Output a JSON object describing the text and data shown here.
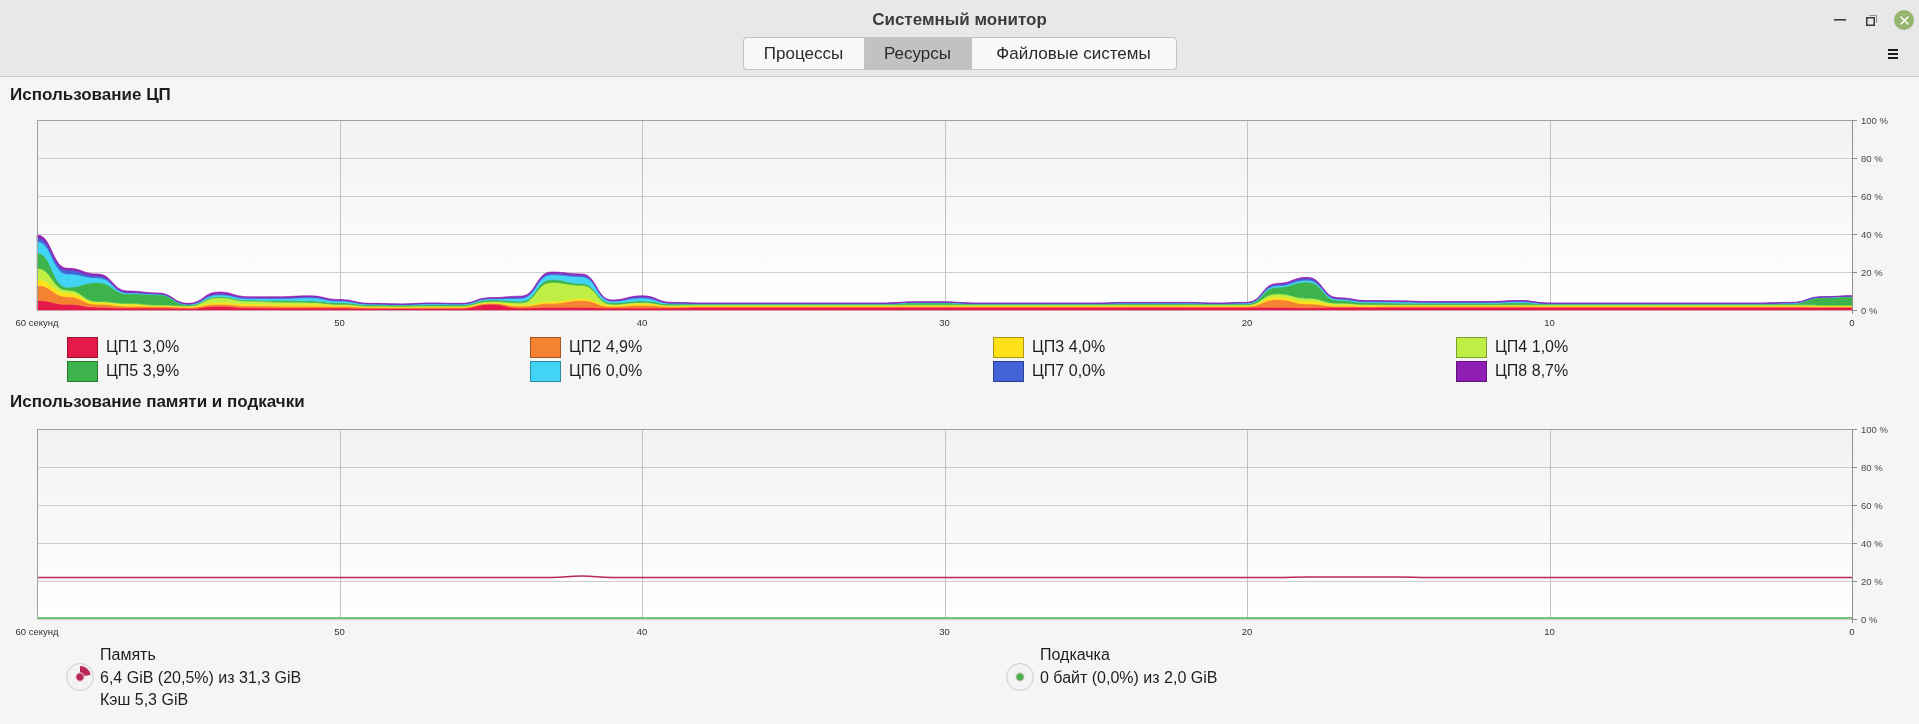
{
  "window": {
    "title": "Системный монитор"
  },
  "tabs": [
    {
      "label": "Процессы",
      "selected": false
    },
    {
      "label": "Ресурсы",
      "selected": true
    },
    {
      "label": "Файловые системы",
      "selected": false
    }
  ],
  "cpu": {
    "title": "Использование ЦП",
    "chart_data": {
      "type": "area",
      "stacked": true,
      "grid": true,
      "xlim": [
        60,
        0
      ],
      "ylim": [
        0,
        100
      ],
      "xticks": [
        {
          "value": 60,
          "label": "60 секунд"
        },
        50,
        40,
        30,
        20,
        10,
        0
      ],
      "yticks": [
        {
          "value": 0,
          "label": "0 %"
        },
        {
          "value": 20,
          "label": "20 %"
        },
        {
          "value": 40,
          "label": "40 %"
        },
        {
          "value": 60,
          "label": "60 %"
        },
        {
          "value": 80,
          "label": "80 %"
        },
        {
          "value": 100,
          "label": "100 %"
        }
      ],
      "x": [
        60,
        59,
        58,
        57,
        56,
        55,
        54,
        53,
        52,
        51,
        50,
        49,
        48,
        47,
        46,
        45,
        44,
        43,
        42,
        41,
        40,
        39,
        38,
        37,
        36,
        35,
        34,
        33,
        32,
        31,
        30,
        29,
        28,
        27,
        26,
        25,
        24,
        23,
        22,
        21,
        20,
        19,
        18,
        17,
        16,
        15,
        14,
        13,
        12,
        11,
        10,
        9,
        8,
        7,
        6,
        5,
        4,
        3,
        2,
        1,
        0
      ],
      "series": [
        {
          "name": "ЦП1",
          "color": "#e6194b",
          "values": [
            5,
            3,
            1.5,
            1,
            1,
            0.8,
            2,
            1.2,
            1,
            1,
            1,
            0.8,
            0.8,
            0.8,
            0.8,
            3,
            1,
            1.5,
            1.5,
            1,
            1,
            1,
            1.4,
            1.4,
            1.4,
            1.4,
            1.4,
            1.4,
            1.4,
            1.4,
            1.4,
            1.4,
            1.4,
            1.4,
            1.4,
            1.4,
            1.4,
            1.4,
            1.4,
            1.4,
            1.4,
            1.5,
            1.2,
            1.4,
            1.4,
            1.4,
            1.4,
            1.4,
            1.4,
            1.4,
            1.4,
            1.4,
            1.4,
            1.4,
            1.4,
            1.4,
            1.4,
            1.4,
            1.4,
            1.4,
            1.4
          ]
        },
        {
          "name": "ЦП2",
          "color": "#f58231",
          "values": [
            8,
            4,
            1.5,
            1,
            0.8,
            0.6,
            1,
            1,
            1,
            1,
            0.8,
            0.6,
            0.5,
            0.6,
            0.6,
            0.6,
            1,
            2,
            3.5,
            0.8,
            1.5,
            0.7,
            0.5,
            0.5,
            0.5,
            0.5,
            0.5,
            0.5,
            0.5,
            0.5,
            0.5,
            0.5,
            0.5,
            0.5,
            0.5,
            0.5,
            0.5,
            0.5,
            0.5,
            0.5,
            0.5,
            4,
            2,
            0.6,
            0.5,
            0.6,
            0.6,
            0.6,
            0.6,
            0.6,
            0.5,
            0.5,
            0.5,
            0.5,
            0.5,
            0.5,
            0.5,
            0.5,
            0.5,
            0.3,
            0.3
          ]
        },
        {
          "name": "ЦП3",
          "color": "#ffe119",
          "values": [
            3,
            2,
            1,
            1,
            0.5,
            0.5,
            1,
            1,
            1,
            1,
            0.7,
            0.4,
            0.4,
            0.4,
            0.4,
            0.4,
            0.8,
            1,
            1,
            0.7,
            1,
            0.5,
            0.5,
            0.5,
            0.5,
            0.5,
            0.5,
            0.5,
            0.5,
            0.5,
            0.5,
            0.5,
            0.5,
            0.5,
            0.5,
            0.5,
            0.5,
            0.5,
            0.5,
            0.5,
            0.5,
            1.5,
            1.5,
            0.8,
            0.6,
            0.5,
            0.5,
            0.5,
            0.5,
            0.5,
            0.5,
            0.5,
            0.5,
            0.5,
            0.5,
            0.5,
            0.5,
            0.5,
            0.5,
            0.5,
            0.5
          ]
        },
        {
          "name": "ЦП4",
          "color": "#bfef45",
          "values": [
            6,
            1.5,
            0.5,
            0.5,
            0.3,
            0.3,
            2.5,
            1.5,
            1.2,
            1,
            0.5,
            0.3,
            0.3,
            0.3,
            0.3,
            0.5,
            1,
            10,
            7,
            0.5,
            0.5,
            0.3,
            0.3,
            0.3,
            0.3,
            0.3,
            0.3,
            0.3,
            0.3,
            0.3,
            0.3,
            0.3,
            0.3,
            0.3,
            0.3,
            0.3,
            0.3,
            0.3,
            0.3,
            0.3,
            0.3,
            1.5,
            1.5,
            0.8,
            0.4,
            0.3,
            0.3,
            0.3,
            0.3,
            0.3,
            0.3,
            0.3,
            0.3,
            0.3,
            0.3,
            0.3,
            0.3,
            0.3,
            0.3,
            0.3,
            0.3
          ]
        },
        {
          "name": "ЦП5",
          "color": "#3cb44b",
          "values": [
            8,
            1.5,
            10,
            5,
            5.5,
            0.5,
            0.5,
            0.5,
            0.8,
            0.8,
            0.8,
            0.6,
            0.5,
            0.6,
            0.6,
            0.8,
            0.8,
            1.5,
            1,
            0.8,
            0.8,
            0.6,
            0.4,
            0.4,
            0.4,
            0.4,
            0.4,
            0.4,
            0.4,
            1,
            1,
            0.4,
            0.4,
            0.4,
            0.4,
            0.4,
            0.7,
            0.7,
            0.7,
            0.4,
            0.6,
            3.5,
            8.5,
            1.5,
            0.9,
            0.8,
            0.7,
            0.7,
            0.7,
            1,
            0.4,
            0.4,
            0.4,
            0.4,
            0.4,
            0.4,
            0.4,
            0.4,
            0.7,
            4,
            4.5
          ]
        },
        {
          "name": "ЦП6",
          "color": "#42d4f4",
          "values": [
            6,
            7,
            2.5,
            0.5,
            0.3,
            0.3,
            1,
            0.8,
            1,
            1.7,
            0.9,
            0.4,
            0.3,
            0.5,
            0.4,
            0.6,
            1.5,
            2.5,
            3.5,
            0.8,
            1.5,
            0.4,
            0.3,
            0.3,
            0.3,
            0.3,
            0.3,
            0.3,
            0.3,
            0.3,
            0.3,
            0.3,
            0.3,
            0.3,
            0.3,
            0.3,
            0.3,
            0.3,
            0.3,
            0.3,
            0.4,
            0.8,
            1,
            0.6,
            0.5,
            0.6,
            0.4,
            0.4,
            0.4,
            0.6,
            0.3,
            0.3,
            0.3,
            0.3,
            0.3,
            0.3,
            0.3,
            0.3,
            0.3,
            0.2,
            0.2
          ]
        },
        {
          "name": "ЦП7",
          "color": "#4363d8",
          "values": [
            2,
            2,
            1,
            0.3,
            0.2,
            0.2,
            0.5,
            0.5,
            0.5,
            0.5,
            0.4,
            0.2,
            0.2,
            0.3,
            0.2,
            0.3,
            0.6,
            0.8,
            0.8,
            0.4,
            0.7,
            0.2,
            0.1,
            0.1,
            0.1,
            0.1,
            0.1,
            0.1,
            0.1,
            0.1,
            0.1,
            0.1,
            0.1,
            0.1,
            0.1,
            0.1,
            0.1,
            0.1,
            0.1,
            0.1,
            0.1,
            0.7,
            1,
            0.4,
            0.4,
            0.3,
            0.4,
            0.4,
            0.4,
            0.4,
            0.1,
            0.1,
            0.1,
            0.1,
            0.1,
            0.1,
            0.1,
            0.1,
            0.1,
            0.1,
            0.1
          ]
        },
        {
          "name": "ЦП8",
          "color": "#911eb4",
          "values": [
            1.5,
            1,
            1,
            0.7,
            0.4,
            0.3,
            1,
            0.5,
            0.5,
            0.5,
            0.4,
            0.2,
            0.2,
            0.2,
            0.2,
            0.3,
            0.6,
            0.7,
            0.7,
            0.3,
            0.5,
            0.3,
            0.2,
            0.2,
            0.2,
            0.2,
            0.2,
            0.2,
            0.2,
            0.2,
            0.2,
            0.2,
            0.2,
            0.2,
            0.2,
            0.2,
            0.2,
            0.2,
            0.2,
            0.2,
            0.2,
            0.5,
            0.5,
            0.4,
            0.3,
            0.4,
            0.2,
            0.2,
            0.2,
            0.2,
            0.2,
            0.2,
            0.2,
            0.2,
            0.2,
            0.2,
            0.2,
            0.2,
            0.2,
            0.2,
            0.2
          ]
        }
      ]
    },
    "legend": [
      {
        "reading": "3,0%"
      },
      {
        "reading": "4,9%"
      },
      {
        "reading": "4,0%"
      },
      {
        "reading": "1,0%"
      },
      {
        "reading": "3,9%"
      },
      {
        "reading": "0,0%"
      },
      {
        "reading": "0,0%"
      },
      {
        "reading": "8,7%"
      }
    ]
  },
  "memory": {
    "title": "Использование памяти и подкачки",
    "chart_data": {
      "type": "line",
      "grid": true,
      "xlim": [
        60,
        0
      ],
      "ylim": [
        0,
        100
      ],
      "xticks": [
        {
          "value": 60,
          "label": "60 секунд"
        },
        50,
        40,
        30,
        20,
        10,
        0
      ],
      "yticks": [
        {
          "value": 0,
          "label": "0 %"
        },
        {
          "value": 20,
          "label": "20 %"
        },
        {
          "value": 40,
          "label": "40 %"
        },
        {
          "value": 60,
          "label": "60 %"
        },
        {
          "value": 80,
          "label": "80 %"
        },
        {
          "value": 100,
          "label": "100 %"
        }
      ],
      "x": [
        60,
        59,
        58,
        57,
        56,
        55,
        54,
        53,
        52,
        51,
        50,
        49,
        48,
        47,
        46,
        45,
        44,
        43,
        42,
        41,
        40,
        39,
        38,
        37,
        36,
        35,
        34,
        33,
        32,
        31,
        30,
        29,
        28,
        27,
        26,
        25,
        24,
        23,
        22,
        21,
        20,
        19,
        18,
        17,
        16,
        15,
        14,
        13,
        12,
        11,
        10,
        9,
        8,
        7,
        6,
        5,
        4,
        3,
        2,
        1,
        0
      ],
      "series": [
        {
          "name": "Память",
          "color": "#b8285a",
          "values": [
            21.8,
            21.8,
            21.8,
            21.8,
            21.8,
            21.8,
            21.8,
            21.8,
            21.8,
            21.8,
            21.8,
            21.8,
            21.8,
            21.8,
            21.8,
            21.8,
            21.8,
            21.8,
            22.6,
            21.8,
            21.8,
            21.8,
            21.8,
            21.8,
            21.8,
            21.8,
            21.8,
            21.8,
            21.8,
            21.8,
            21.8,
            21.8,
            21.8,
            21.8,
            21.8,
            21.8,
            21.8,
            21.8,
            21.8,
            21.8,
            21.8,
            21.8,
            22.1,
            22.1,
            22.1,
            22.1,
            21.8,
            21.8,
            21.8,
            21.8,
            21.8,
            21.8,
            21.8,
            21.8,
            21.8,
            21.8,
            21.8,
            21.8,
            21.8,
            21.8,
            21.8
          ]
        },
        {
          "name": "Подкачка",
          "color": "#4caf50",
          "values": [
            0,
            0,
            0,
            0,
            0,
            0,
            0,
            0,
            0,
            0,
            0,
            0,
            0,
            0,
            0,
            0,
            0,
            0,
            0,
            0,
            0,
            0,
            0,
            0,
            0,
            0,
            0,
            0,
            0,
            0,
            0,
            0,
            0,
            0,
            0,
            0,
            0,
            0,
            0,
            0,
            0,
            0,
            0,
            0,
            0,
            0,
            0,
            0,
            0,
            0,
            0,
            0,
            0,
            0,
            0,
            0,
            0,
            0,
            0,
            0,
            0
          ]
        }
      ]
    },
    "summary": [
      {
        "lines": [
          "6,4 GiB (20,5%) из 31,3 GiB",
          "Кэш 5,3 GiB"
        ]
      },
      {
        "lines": [
          "0 байт (0,0%) из 2,0 GiB"
        ]
      }
    ]
  }
}
